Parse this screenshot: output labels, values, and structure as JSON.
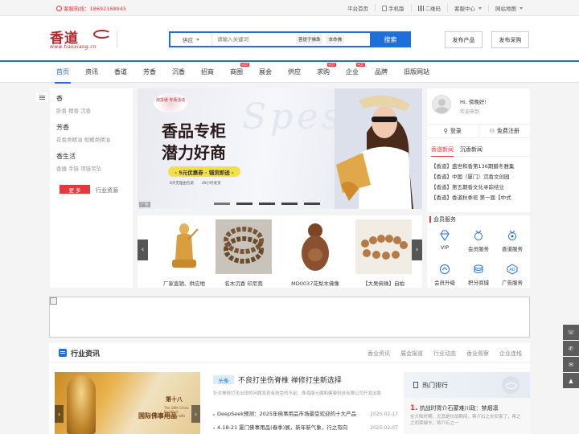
{
  "topbar": {
    "hotline": "客服热线：18692168945",
    "links": [
      {
        "label": "平台首页",
        "icon": ""
      },
      {
        "label": "手机版",
        "icon": "mobile-icon"
      },
      {
        "label": "二维码",
        "icon": "qrcode-icon"
      },
      {
        "label": "客服中心",
        "icon": "caret"
      },
      {
        "label": "网站地图",
        "icon": "caret"
      }
    ]
  },
  "logo": {
    "name": "香道",
    "url": "www.tiaoxiang.cn"
  },
  "search": {
    "category": "供应",
    "placeholder": "请输入关键词",
    "tags": [
      "菩提子佛珠",
      "本命佛"
    ],
    "button": "搜索"
  },
  "header_buttons": {
    "publish_product": "发布产品",
    "publish_purchase": "发布采购"
  },
  "nav": {
    "items": [
      {
        "label": "首页",
        "active": true,
        "hot": false
      },
      {
        "label": "资讯",
        "active": false,
        "hot": false
      },
      {
        "label": "香道",
        "active": false,
        "hot": false
      },
      {
        "label": "芳香",
        "active": false,
        "hot": false
      },
      {
        "label": "沉香",
        "active": false,
        "hot": false
      },
      {
        "label": "招商",
        "active": false,
        "hot": false
      },
      {
        "label": "商圈",
        "active": false,
        "hot": true
      },
      {
        "label": "展会",
        "active": false,
        "hot": false
      },
      {
        "label": "供应",
        "active": false,
        "hot": false
      },
      {
        "label": "求购",
        "active": false,
        "hot": true
      },
      {
        "label": "企业",
        "active": false,
        "hot": true
      },
      {
        "label": "品牌",
        "active": false,
        "hot": false
      },
      {
        "label": "旧版网站",
        "active": false,
        "hot": false
      }
    ],
    "hot_label": "HOT"
  },
  "categories": [
    {
      "title": "香",
      "subs": "卧香  檀香  沉香"
    },
    {
      "title": "芳香",
      "subs": "花香类精油  柑橘类精油"
    },
    {
      "title": "香生活",
      "subs": "香器  手链  项链吊坠"
    }
  ],
  "more": {
    "button": "更 多",
    "text": "行业资源"
  },
  "banner": {
    "badge": "淘货通 专场活动",
    "line1": "香品专柜",
    "line2": "潜力好商",
    "promo": "- 5元优惠券 · 铺货即送 -",
    "sub": [
      "8天无理由包退",
      "48小时发货"
    ],
    "ad": "广告",
    "bg_text": "Spes"
  },
  "products": [
    {
      "caption": "厂家直销、供应地"
    },
    {
      "caption": "名木沉香 印尼莞"
    },
    {
      "caption": "MD0037花梨木佛像"
    },
    {
      "caption": "【大吴佛珠】自拍"
    }
  ],
  "user": {
    "greeting": "Hi, 傍晚好!",
    "welcome": "欢迎来到",
    "login": "登录",
    "register": "免费注册"
  },
  "news_tabs": [
    {
      "label": "香道新闻",
      "on": true
    },
    {
      "label": "沉香新闻",
      "on": false
    }
  ],
  "news": [
    "【香道】盛世和香第136期腊冬雅集",
    "【香道】中国（厦门）沉香文创园",
    "【香道】第五期香文化寻踪结业",
    "【香道】香道秋季班 第一届【中式"
  ],
  "member": {
    "title": "会员服务",
    "services": [
      {
        "label": "VIP",
        "icon": "diamond-icon"
      },
      {
        "label": "会员服务",
        "icon": "medal-icon"
      },
      {
        "label": "香道服务",
        "icon": "medal-icon"
      },
      {
        "label": "会员升级",
        "icon": "upgrade-icon"
      },
      {
        "label": "积分商城",
        "icon": "coins-icon"
      },
      {
        "label": "广告服务",
        "icon": "ad-icon"
      }
    ]
  },
  "industry": {
    "title": "行业资讯",
    "subs": [
      "香业资讯",
      "展会报道",
      "行业动态",
      "香业观察",
      "企业连线"
    ],
    "image_text": {
      "t1": "第十八",
      "t2": "国际佛事用品",
      "t3": "The 18th China Buddhist Items&Crafts"
    },
    "headline_tag": "头条",
    "headline": "不良打坐伤脊椎 禅修打坐新选择",
    "summary": "针对禅修打坐出现的问题发现有效受的不足，珠海康元阁和健康科技有限公司开发出款",
    "list": [
      {
        "title": "DeepSeek预测：2025年佛事用品市场最受欢迎的十大产品",
        "date": "2025-02-17"
      },
      {
        "title": "4.18-21 厦门佛事用品(春季)展，新年新气象，行之有向",
        "date": "2025-02-07"
      }
    ]
  },
  "hotrank": {
    "title": "热门排行",
    "first_rank": "1.",
    "first_title": "抗战时胃介石蒙难川政：禁烟凛",
    "first_desc": "在大陆时期，尤其是抗战期间，蒋介石之夫安家了，蒋之之而禁烟令，将介石之一"
  },
  "side_tools": [
    "headset-icon",
    "phone-icon",
    "wechat-icon",
    "top-icon"
  ]
}
